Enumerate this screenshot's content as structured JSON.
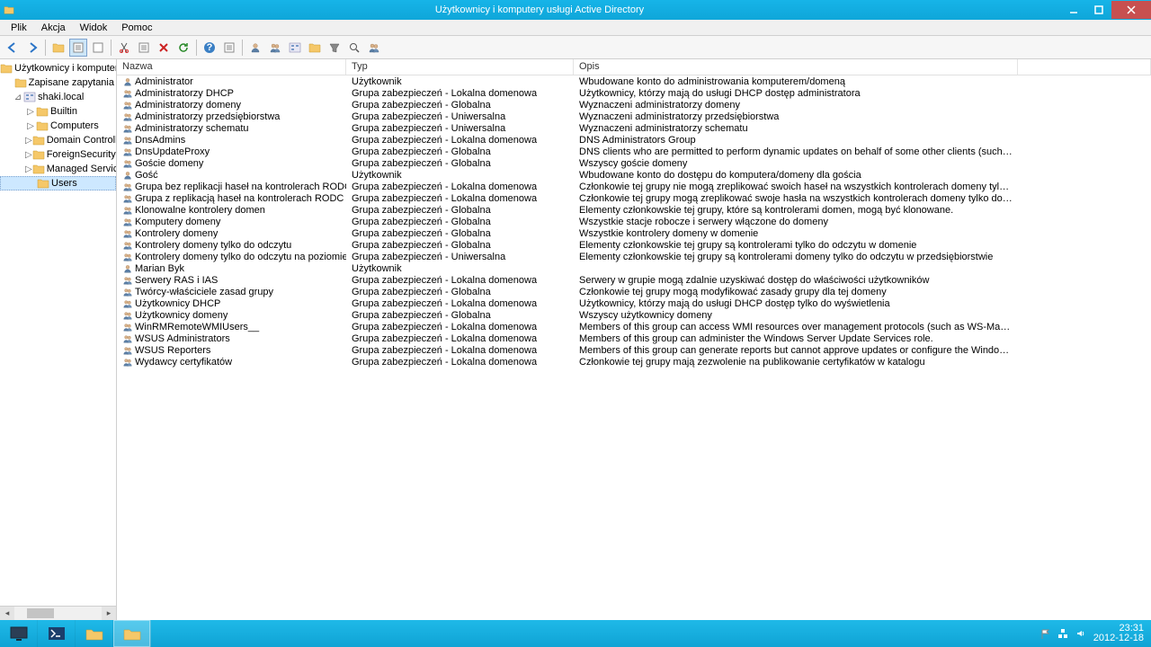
{
  "window": {
    "title": "Użytkownicy i komputery usługi Active Directory"
  },
  "menu": {
    "plik": "Plik",
    "akcja": "Akcja",
    "widok": "Widok",
    "pomoc": "Pomoc"
  },
  "tree": {
    "root": "Użytkownicy i komputery usługi",
    "nodes": [
      {
        "indent": 1,
        "exp": "",
        "label": "Zapisane zapytania",
        "icon": "folder"
      },
      {
        "indent": 1,
        "exp": "⊿",
        "label": "shaki.local",
        "icon": "domain"
      },
      {
        "indent": 2,
        "exp": "▷",
        "label": "Builtin",
        "icon": "folder"
      },
      {
        "indent": 2,
        "exp": "▷",
        "label": "Computers",
        "icon": "folder"
      },
      {
        "indent": 2,
        "exp": "▷",
        "label": "Domain Controllers",
        "icon": "folder"
      },
      {
        "indent": 2,
        "exp": "▷",
        "label": "ForeignSecurityPrincipals",
        "icon": "folder"
      },
      {
        "indent": 2,
        "exp": "▷",
        "label": "Managed Service Accounts",
        "icon": "folder"
      },
      {
        "indent": 2,
        "exp": "",
        "label": "Users",
        "icon": "folder",
        "selected": true
      }
    ]
  },
  "columns": {
    "c1": "Nazwa",
    "c2": "Typ",
    "c3": "Opis"
  },
  "rows": [
    {
      "icon": "user",
      "n": "Administrator",
      "t": "Użytkownik",
      "o": "Wbudowane konto do administrowania komputerem/domeną"
    },
    {
      "icon": "group",
      "n": "Administratorzy DHCP",
      "t": "Grupa zabezpieczeń - Lokalna domenowa",
      "o": "Użytkownicy, którzy mają do usługi DHCP dostęp administratora"
    },
    {
      "icon": "group",
      "n": "Administratorzy domeny",
      "t": "Grupa zabezpieczeń - Globalna",
      "o": "Wyznaczeni administratorzy domeny"
    },
    {
      "icon": "group",
      "n": "Administratorzy przedsiębiorstwa",
      "t": "Grupa zabezpieczeń - Uniwersalna",
      "o": "Wyznaczeni administratorzy przedsiębiorstwa"
    },
    {
      "icon": "group",
      "n": "Administratorzy schematu",
      "t": "Grupa zabezpieczeń - Uniwersalna",
      "o": "Wyznaczeni administratorzy schematu"
    },
    {
      "icon": "group",
      "n": "DnsAdmins",
      "t": "Grupa zabezpieczeń - Lokalna domenowa",
      "o": "DNS Administrators Group"
    },
    {
      "icon": "group",
      "n": "DnsUpdateProxy",
      "t": "Grupa zabezpieczeń - Globalna",
      "o": "DNS clients who are permitted to perform dynamic updates on behalf of some other clients (such as DHCP servers)."
    },
    {
      "icon": "group",
      "n": "Goście domeny",
      "t": "Grupa zabezpieczeń - Globalna",
      "o": "Wszyscy goście domeny"
    },
    {
      "icon": "user",
      "n": "Gość",
      "t": "Użytkownik",
      "o": "Wbudowane konto do dostępu do komputera/domeny dla gościa"
    },
    {
      "icon": "group",
      "n": "Grupa bez replikacji haseł na kontrolerach RODC",
      "t": "Grupa zabezpieczeń - Lokalna domenowa",
      "o": "Członkowie tej grupy nie mogą zreplikować swoich haseł na wszystkich kontrolerach domeny tylko do odczytu, które znajdują się w dome..."
    },
    {
      "icon": "group",
      "n": "Grupa z replikacją haseł na kontrolerach RODC",
      "t": "Grupa zabezpieczeń - Lokalna domenowa",
      "o": "Członkowie tej grupy mogą zreplikować swoje hasła na wszystkich kontrolerach domeny tylko do odczytu, które znajdują się w domenie."
    },
    {
      "icon": "group",
      "n": "Klonowalne kontrolery domen",
      "t": "Grupa zabezpieczeń - Globalna",
      "o": "Elementy członkowskie tej grupy, które są kontrolerami domen, mogą być klonowane."
    },
    {
      "icon": "group",
      "n": "Komputery domeny",
      "t": "Grupa zabezpieczeń - Globalna",
      "o": "Wszystkie stacje robocze i serwery włączone do domeny"
    },
    {
      "icon": "group",
      "n": "Kontrolery domeny",
      "t": "Grupa zabezpieczeń - Globalna",
      "o": "Wszystkie kontrolery domeny w domenie"
    },
    {
      "icon": "group",
      "n": "Kontrolery domeny tylko do odczytu",
      "t": "Grupa zabezpieczeń - Globalna",
      "o": "Elementy członkowskie tej grupy są kontrolerami tylko do odczytu w domenie"
    },
    {
      "icon": "group",
      "n": "Kontrolery domeny tylko do odczytu na poziomie organizacji",
      "t": "Grupa zabezpieczeń - Uniwersalna",
      "o": "Elementy członkowskie tej grupy są kontrolerami domeny tylko do odczytu w przedsiębiorstwie"
    },
    {
      "icon": "user",
      "n": "Marian Byk",
      "t": "Użytkownik",
      "o": ""
    },
    {
      "icon": "group",
      "n": "Serwery RAS i IAS",
      "t": "Grupa zabezpieczeń - Lokalna domenowa",
      "o": "Serwery w grupie mogą zdalnie uzyskiwać dostęp do właściwości użytkowników"
    },
    {
      "icon": "group",
      "n": "Twórcy-właściciele zasad grupy",
      "t": "Grupa zabezpieczeń - Globalna",
      "o": "Członkowie tej grupy mogą modyfikować zasady grupy dla tej domeny"
    },
    {
      "icon": "group",
      "n": "Użytkownicy DHCP",
      "t": "Grupa zabezpieczeń - Lokalna domenowa",
      "o": "Użytkownicy, którzy mają do usługi DHCP dostęp tylko do wyświetlenia"
    },
    {
      "icon": "group",
      "n": "Użytkownicy domeny",
      "t": "Grupa zabezpieczeń - Globalna",
      "o": "Wszyscy użytkownicy domeny"
    },
    {
      "icon": "group",
      "n": "WinRMRemoteWMIUsers__",
      "t": "Grupa zabezpieczeń - Lokalna domenowa",
      "o": "Members of this group can access WMI resources over management protocols (such as WS-Management via the Windows Remote Mana..."
    },
    {
      "icon": "group",
      "n": "WSUS Administrators",
      "t": "Grupa zabezpieczeń - Lokalna domenowa",
      "o": "Members of this group can administer the Windows Server Update Services role."
    },
    {
      "icon": "group",
      "n": "WSUS Reporters",
      "t": "Grupa zabezpieczeń - Lokalna domenowa",
      "o": "Members of this group can generate reports but cannot approve updates or configure the Windows Server Update Services role."
    },
    {
      "icon": "group",
      "n": "Wydawcy certyfikatów",
      "t": "Grupa zabezpieczeń - Lokalna domenowa",
      "o": "Członkowie tej grupy mają zezwolenie na publikowanie certyfikatów w katalogu"
    }
  ],
  "tray": {
    "time": "23:31",
    "date": "2012-12-18"
  }
}
